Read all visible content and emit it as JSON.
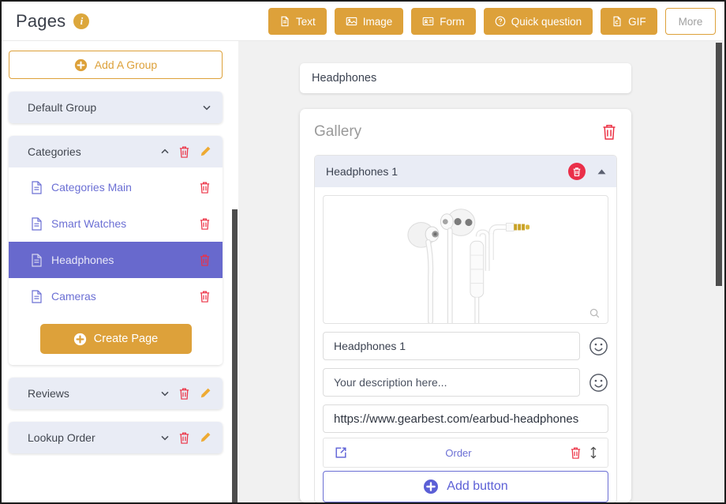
{
  "header": {
    "title": "Pages",
    "info_icon": "info-circle-icon",
    "tools": [
      {
        "label": "Text",
        "icon": "text-file-icon",
        "style": "filled"
      },
      {
        "label": "Image",
        "icon": "image-icon",
        "style": "filled"
      },
      {
        "label": "Form",
        "icon": "form-icon",
        "style": "filled"
      },
      {
        "label": "Quick question",
        "icon": "question-circle-icon",
        "style": "filled"
      },
      {
        "label": "GIF",
        "icon": "gif-file-icon",
        "style": "filled"
      },
      {
        "label": "More",
        "icon": "",
        "style": "outline"
      }
    ]
  },
  "sidebar": {
    "add_group_label": "Add A Group",
    "add_group_icon": "plus-circle-icon",
    "create_page_label": "Create Page",
    "create_page_icon": "plus-circle-icon",
    "groups": [
      {
        "name": "Default Group",
        "expanded": false,
        "chevron": "chevron-down-icon",
        "has_actions": false,
        "pages": []
      },
      {
        "name": "Categories",
        "expanded": true,
        "chevron": "chevron-up-icon",
        "has_actions": true,
        "pages": [
          {
            "name": "Categories Main",
            "selected": false
          },
          {
            "name": "Smart Watches",
            "selected": false
          },
          {
            "name": "Headphones",
            "selected": true
          },
          {
            "name": "Cameras",
            "selected": false
          }
        ]
      },
      {
        "name": "Reviews",
        "expanded": false,
        "chevron": "chevron-down-icon",
        "has_actions": true,
        "pages": []
      },
      {
        "name": "Lookup Order",
        "expanded": false,
        "chevron": "chevron-down-icon",
        "has_actions": true,
        "pages": []
      }
    ]
  },
  "main": {
    "page_title": "Headphones",
    "gallery": {
      "label": "Gallery",
      "delete_icon": "trash-icon",
      "item": {
        "header_title": "Headphones 1",
        "delete_icon": "trash-icon",
        "collapse_icon": "caret-up-icon",
        "image_alt": "white earbud headphones",
        "zoom_icon": "magnifier-icon",
        "name_value": "Headphones 1",
        "name_emoji_icon": "emoji-smiley-icon",
        "description_value": "Your description here...",
        "description_emoji_icon": "emoji-smiley-icon",
        "url_value": "https://www.gearbest.com/earbud-headphones",
        "order_row": {
          "external_icon": "external-link-icon",
          "label": "Order",
          "delete_icon": "trash-icon",
          "reorder_icon": "up-down-arrow-icon"
        },
        "add_button_label": "Add button",
        "add_button_icon": "plus-circle-icon"
      }
    }
  },
  "colors": {
    "accent_orange": "#dda13a",
    "accent_purple": "#6869cd",
    "danger_red": "#ec3144",
    "group_header_bg": "#e9ecf5",
    "canvas_bg": "#f1f1f1"
  }
}
